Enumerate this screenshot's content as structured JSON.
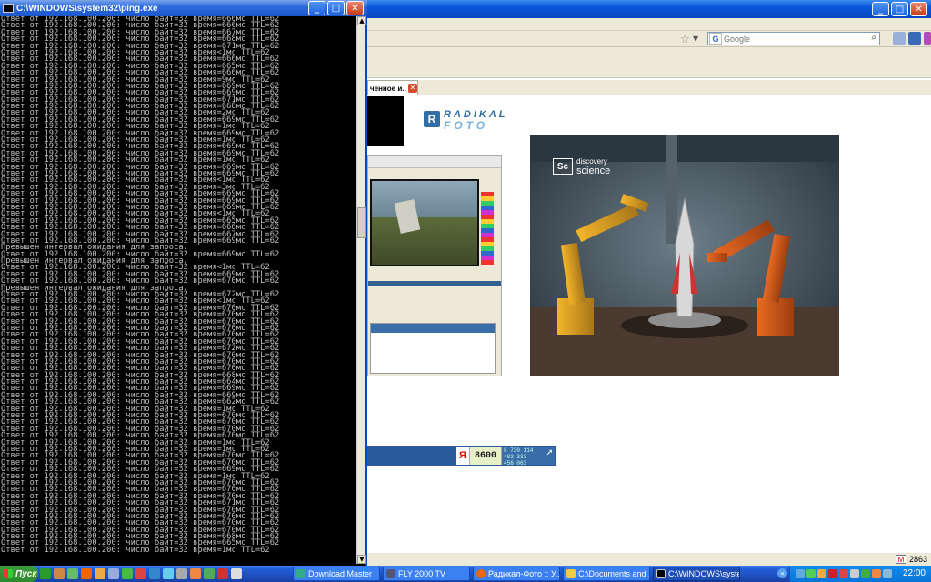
{
  "console": {
    "title": "C:\\WINDOWS\\system32\\ping.exe",
    "lines": [
      "Ответ от 192.168.100.200: число байт=32 время=666мс TTL=62",
      "Ответ от 192.168.100.200: число байт=32 время=666мс TTL=62",
      "Ответ от 192.168.100.200: число байт=32 время=667мс TTL=62",
      "Ответ от 192.168.100.200: число байт=32 время=668мс TTL=62",
      "Ответ от 192.168.100.200: число байт=32 время=671мс TTL=62",
      "Ответ от 192.168.100.200: число байт=32 время<1мс TTL=62",
      "Ответ от 192.168.100.200: число байт=32 время=666мс TTL=62",
      "Ответ от 192.168.100.200: число байт=32 время=665мс TTL=62",
      "Ответ от 192.168.100.200: число байт=32 время=666мс TTL=62",
      "Ответ от 192.168.100.200: число байт=32 время=9мс TTL=62",
      "Ответ от 192.168.100.200: число байт=32 время=669мс TTL=62",
      "Ответ от 192.168.100.200: число байт=32 время=669мс TTL=62",
      "Ответ от 192.168.100.200: число байт=32 время=671мс TTL=62",
      "Ответ от 192.168.100.200: число байт=32 время=668мс TTL=62",
      "Ответ от 192.168.100.200: число байт=32 время=2мс TTL=62",
      "Ответ от 192.168.100.200: число байт=32 время=669мс TTL=62",
      "Ответ от 192.168.100.200: число байт=32 время=1мс TTL=62",
      "Ответ от 192.168.100.200: число байт=32 время=669мс TTL=62",
      "Ответ от 192.168.100.200: число байт=32 время=1мс TTL=62",
      "Ответ от 192.168.100.200: число байт=32 время=669мс TTL=62",
      "Ответ от 192.168.100.200: число байт=32 время=669мс TTL=62",
      "Ответ от 192.168.100.200: число байт=32 время=1мс TTL=62",
      "Ответ от 192.168.100.200: число байт=32 время=669мс TTL=62",
      "Ответ от 192.168.100.200: число байт=32 время=669мс TTL=62",
      "Ответ от 192.168.100.200: число байт=32 время<1мс TTL=62",
      "Ответ от 192.168.100.200: число байт=32 время=3мс TTL=62",
      "Ответ от 192.168.100.200: число байт=32 время=669мс TTL=62",
      "Ответ от 192.168.100.200: число байт=32 время=669мс TTL=62",
      "Ответ от 192.168.100.200: число байт=32 время=669мс TTL=62",
      "Ответ от 192.168.100.200: число байт=32 время<1мс TTL=62",
      "Ответ от 192.168.100.200: число байт=32 время=665мс TTL=62",
      "Ответ от 192.168.100.200: число байт=32 время=666мс TTL=62",
      "Ответ от 192.168.100.200: число байт=32 время=667мс TTL=62",
      "Ответ от 192.168.100.200: число байт=32 время=669мс TTL=62",
      "Превышен интервал ожидания для запроса.",
      "Ответ от 192.168.100.200: число байт=32 время=669мс TTL=62",
      "Превышен интервал ожидания для запроса.",
      "Ответ от 192.168.100.200: число байт=32 время<1мс TTL=62",
      "Ответ от 192.168.100.200: число байт=32 время=669мс TTL=62",
      "Ответ от 192.168.100.200: число байт=32 время=670мс TTL=62",
      "Превышен интервал ожидания для запроса.",
      "Ответ от 192.168.100.200: число байт=32 время=672мс TTL=62",
      "Ответ от 192.168.100.200: число байт=32 время<1мс TTL=62",
      "Ответ от 192.168.100.200: число байт=32 время=670мс TTL=62",
      "Ответ от 192.168.100.200: число байт=32 время=670мс TTL=62",
      "Ответ от 192.168.100.200: число байт=32 время=670мс TTL=62",
      "Ответ от 192.168.100.200: число байт=32 время=670мс TTL=62",
      "Ответ от 192.168.100.200: число байт=32 время=670мс TTL=62",
      "Ответ от 192.168.100.200: число байт=32 время=670мс TTL=62",
      "Ответ от 192.168.100.200: число байт=32 время=672мс TTL=62",
      "Ответ от 192.168.100.200: число байт=32 время=670мс TTL=62",
      "Ответ от 192.168.100.200: число байт=32 время=670мс TTL=62",
      "Ответ от 192.168.100.200: число байт=32 время=670мс TTL=62",
      "Ответ от 192.168.100.200: число байт=32 время=668мс TTL=62",
      "Ответ от 192.168.100.200: число байт=32 время=664мс TTL=62",
      "Ответ от 192.168.100.200: число байт=32 время=669мс TTL=62",
      "Ответ от 192.168.100.200: число байт=32 время=669мс TTL=62",
      "Ответ от 192.168.100.200: число байт=32 время=662мс TTL=62",
      "Ответ от 192.168.100.200: число байт=32 время=1мс TTL=62",
      "Ответ от 192.168.100.200: число байт=32 время=670мс TTL=62",
      "Ответ от 192.168.100.200: число байт=32 время=670мс TTL=62",
      "Ответ от 192.168.100.200: число байт=32 время=670мс TTL=62",
      "Ответ от 192.168.100.200: число байт=32 время=670мс TTL=62",
      "Ответ от 192.168.100.200: число байт=32 время=1мс TTL=62",
      "Ответ от 192.168.100.200: число байт=32 время=1мс TTL=62",
      "Ответ от 192.168.100.200: число байт=32 время=670мс TTL=62",
      "Ответ от 192.168.100.200: число байт=32 время=670мс TTL=62",
      "Ответ от 192.168.100.200: число байт=32 время=669мс TTL=62",
      "Ответ от 192.168.100.200: число байт=32 время=1мс TTL=62",
      "Ответ от 192.168.100.200: число байт=32 время=670мс TTL=62",
      "Ответ от 192.168.100.200: число байт=32 время=670мс TTL=62",
      "Ответ от 192.168.100.200: число байт=32 время=670мс TTL=62",
      "Ответ от 192.168.100.200: число байт=32 время=671мс TTL=62",
      "Ответ от 192.168.100.200: число байт=32 время=670мс TTL=62",
      "Ответ от 192.168.100.200: число байт=32 время=670мс TTL=62",
      "Ответ от 192.168.100.200: число байт=32 время=670мс TTL=62",
      "Ответ от 192.168.100.200: число байт=32 время=670мс TTL=62",
      "Ответ от 192.168.100.200: число байт=32 время=668мс TTL=62",
      "Ответ от 192.168.100.200: число байт=32 время=665мс TTL=62",
      "Ответ от 192.168.100.200: число байт=32 время=1мс TTL=62"
    ]
  },
  "browser": {
    "search_placeholder": "Google",
    "search_engine_letter": "G",
    "tab_label": "ченное и...",
    "logo_top": "RADIKAL",
    "logo_bottom": "FOTO",
    "logo_mark": "R",
    "image_channel_mark": "Sc",
    "image_channel_line1": "discovery",
    "image_channel_line2": "science",
    "counter_yandex": "Я",
    "counter_value": "8600",
    "counter_stats": [
      "8 730 114",
      "482 333",
      "456 063"
    ],
    "status_mail_count": "2863"
  },
  "taskbar": {
    "start_label": "Пуск",
    "tasks": [
      "Download Master",
      "FLY 2000 TV",
      "Радикал-Фото :: У...",
      "C:\\Documents and ...",
      "C:\\WINDOWS\\syste..."
    ],
    "clock": "22:00"
  },
  "colors": {
    "console_text": "#c0c0c0",
    "xp_blue": "#245edb",
    "start_green": "#3c9c3c"
  }
}
